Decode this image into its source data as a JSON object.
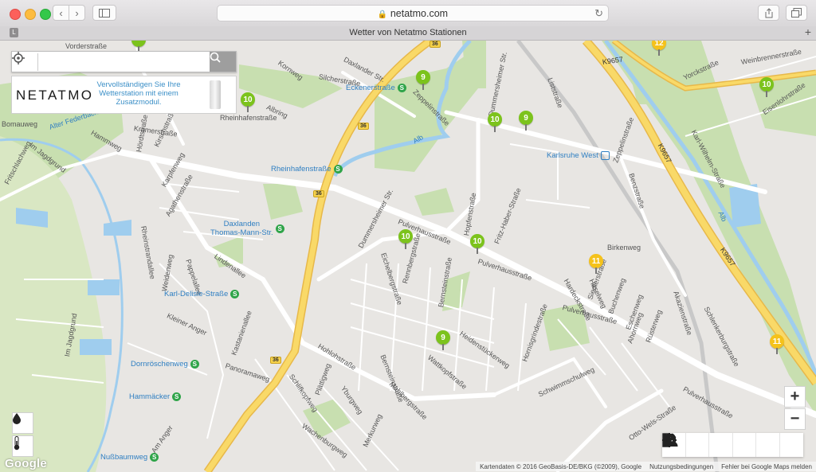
{
  "browser": {
    "url": "netatmo.com",
    "tab_title": "Wetter von Netatmo Stationen",
    "tab_badge": "L",
    "new_tab": "+"
  },
  "search": {
    "placeholder": "",
    "value": ""
  },
  "promo": {
    "logo": "NETATMO",
    "text": "Vervollständigen Sie Ihre Wetterstation mit einem Zusatzmodul."
  },
  "stations": [
    {
      "name_lines": [
        "Eckenerstraße"
      ]
    },
    {
      "name_lines": [
        "Rheinhafenstraße"
      ]
    },
    {
      "name_lines": [
        "Karlsruhe West"
      ]
    },
    {
      "name_lines": [
        "Daxlanden",
        "Thomas-Mann-Str."
      ]
    },
    {
      "name_lines": [
        "Karl-Delisle-Straße"
      ]
    },
    {
      "name_lines": [
        "Dornröschenweg"
      ]
    },
    {
      "name_lines": [
        "Hammäcker"
      ]
    },
    {
      "name_lines": [
        "Nußbaumweg"
      ]
    }
  ],
  "streets": [
    "Vorderstraße",
    "Daxlander Str.",
    "Silcherstraße",
    "Kornweg",
    "Albring",
    "Rheinhafenstraße",
    "Krämerstraße",
    "Hammweg",
    "Alter Federbach",
    "Im Jagdgrund",
    "Fritschlachweg",
    "Hördtstraße",
    "Kirschstraße",
    "Karpfenweg",
    "Agathenstraße",
    "Rheinstrandallee",
    "Lindenallee",
    "Pappelallee",
    "Weidenweg",
    "Kleiner Anger",
    "Kastanienallee",
    "Panoramaweg",
    "Hohlohstraße",
    "Schlifkopfweg",
    "Plättigweg",
    "Yburgweg",
    "Wachenburgweg",
    "Merkurweg",
    "Mahlbergstraße",
    "Bernsteinstraße",
    "Wattkopfstraße",
    "Heidenstückerweg",
    "Eichelbergstraße",
    "Rennbergstraße",
    "Bernsteinstraße",
    "Dummersheimer Str.",
    "Pulverhausstraße",
    "Pulverhausstraße",
    "Pulverhausstraße",
    "Pulverhausstraße",
    "Fritz-Haber-Straße",
    "Hopfenstraße",
    "Hornisgrindestraße",
    "Schwimmschulweg",
    "Hardeckstraße",
    "Haselweg",
    "Siedlerstraße",
    "Buchenweg",
    "Eschenweg",
    "Ahornweg",
    "Rüsterweg",
    "Akazienstraße",
    "Schlenkerburgstraße",
    "Otto-Wels-Straße",
    "Birkenweg",
    "Benzstraße",
    "Zeppelinstraße",
    "Zeppelinstraße",
    "Liststraße",
    "Dummersheimer Str.",
    "Yorckstraße",
    "Weinbrennerstraße",
    "Eisenlohrstraße",
    "Karl-Wilhelm-Straße",
    "Alb",
    "Alb",
    "Im Jagdgrund",
    "Bomauweg",
    "Am Anger"
  ],
  "route_labels": [
    "K9657",
    "K9657",
    "K9657"
  ],
  "road_shields": [
    "36",
    "36",
    "36",
    "36"
  ],
  "markers": [
    {
      "value": "9",
      "color": "#7cc31c"
    },
    {
      "value": "10",
      "color": "#7cc31c"
    },
    {
      "value": "10",
      "color": "#7cc31c"
    },
    {
      "value": "9",
      "color": "#7cc31c"
    },
    {
      "value": "10",
      "color": "#7cc31c"
    },
    {
      "value": "10",
      "color": "#7cc31c"
    },
    {
      "value": "9",
      "color": "#7cc31c"
    },
    {
      "value": "10",
      "color": "#7cc31c"
    },
    {
      "value": "11",
      "color": "#f5c21b"
    },
    {
      "value": "11",
      "color": "#f5c21b"
    },
    {
      "value": "12",
      "color": "#f5c21b"
    }
  ],
  "zoom": {
    "in": "+",
    "out": "−"
  },
  "left_tools": [
    {
      "icon": "rain-drop-icon"
    },
    {
      "icon": "thermometer-icon"
    }
  ],
  "actions": [
    {
      "icon": "star-icon"
    },
    {
      "icon": "share-icon"
    },
    {
      "icon": "info-icon"
    },
    {
      "icon": "settings-gear-icon"
    },
    {
      "icon": "bar-chart-icon"
    },
    {
      "icon": "user-stations-icon"
    }
  ],
  "google_logo": "Google",
  "attribution": {
    "data": "Kartendaten © 2016 GeoBasis-DE/BKG (©2009), Google",
    "terms": "Nutzungsbedingungen",
    "report": "Fehler bei Google Maps melden"
  }
}
